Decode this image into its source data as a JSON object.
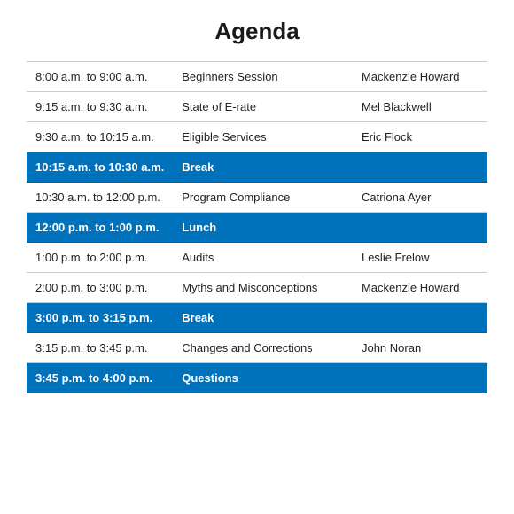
{
  "title": "Agenda",
  "rows": [
    {
      "time": "8:00 a.m. to 9:00 a.m.",
      "session": "Beginners Session",
      "speaker": "Mackenzie Howard",
      "highlight": false
    },
    {
      "time": "9:15 a.m. to 9:30 a.m.",
      "session": "State of E-rate",
      "speaker": "Mel Blackwell",
      "highlight": false
    },
    {
      "time": "9:30 a.m. to 10:15 a.m.",
      "session": "Eligible Services",
      "speaker": "Eric Flock",
      "highlight": false
    },
    {
      "time": "10:15 a.m. to 10:30 a.m.",
      "session": "Break",
      "speaker": "",
      "highlight": true
    },
    {
      "time": "10:30 a.m. to 12:00 p.m.",
      "session": "Program Compliance",
      "speaker": "Catriona Ayer",
      "highlight": false
    },
    {
      "time": "12:00 p.m. to 1:00 p.m.",
      "session": "Lunch",
      "speaker": "",
      "highlight": true
    },
    {
      "time": "1:00 p.m. to 2:00 p.m.",
      "session": "Audits",
      "speaker": "Leslie Frelow",
      "highlight": false
    },
    {
      "time": "2:00 p.m. to 3:00 p.m.",
      "session": "Myths and Misconceptions",
      "speaker": "Mackenzie Howard",
      "highlight": false
    },
    {
      "time": "3:00 p.m. to 3:15 p.m.",
      "session": "Break",
      "speaker": "",
      "highlight": true
    },
    {
      "time": "3:15 p.m. to 3:45 p.m.",
      "session": "Changes and Corrections",
      "speaker": "John Noran",
      "highlight": false
    },
    {
      "time": "3:45 p.m. to 4:00 p.m.",
      "session": "Questions",
      "speaker": "",
      "highlight": true
    }
  ]
}
